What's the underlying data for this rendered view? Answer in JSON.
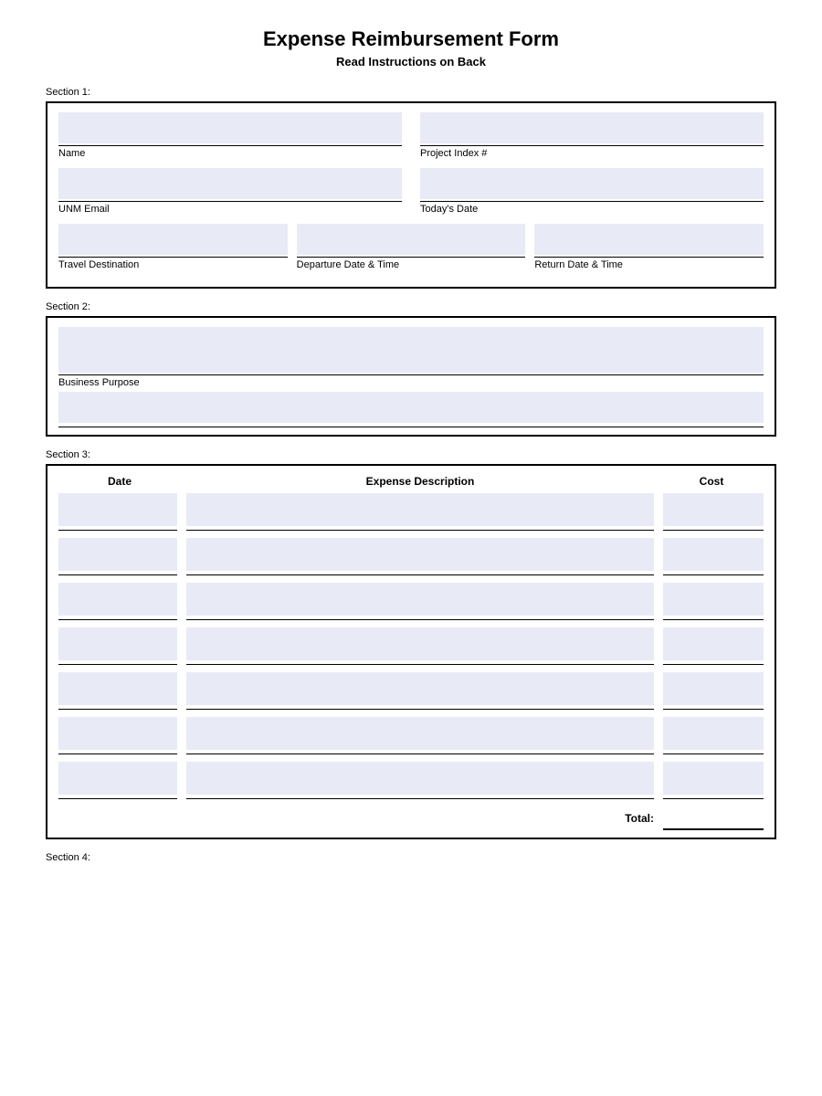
{
  "header": {
    "title": "Expense Reimbursement Form",
    "subtitle": "Read Instructions on Back"
  },
  "section1": {
    "label": "Section 1:",
    "fields": {
      "name_label": "Name",
      "project_index_label": "Project Index #",
      "unm_email_label": "UNM Email",
      "todays_date_label": "Today's Date",
      "travel_destination_label": "Travel Destination",
      "departure_date_label": "Departure Date & Time",
      "return_date_label": "Return Date & Time"
    }
  },
  "section2": {
    "label": "Section 2:",
    "fields": {
      "business_purpose_label": "Business Purpose"
    }
  },
  "section3": {
    "label": "Section 3:",
    "columns": {
      "date": "Date",
      "description": "Expense Description",
      "cost": "Cost"
    },
    "total_label": "Total:",
    "rows": [
      {
        "date": "",
        "description": "",
        "cost": ""
      },
      {
        "date": "",
        "description": "",
        "cost": ""
      },
      {
        "date": "",
        "description": "",
        "cost": ""
      },
      {
        "date": "",
        "description": "",
        "cost": ""
      },
      {
        "date": "",
        "description": "",
        "cost": ""
      },
      {
        "date": "",
        "description": "",
        "cost": ""
      },
      {
        "date": "",
        "description": "",
        "cost": ""
      }
    ]
  },
  "section4": {
    "label": "Section 4:"
  }
}
